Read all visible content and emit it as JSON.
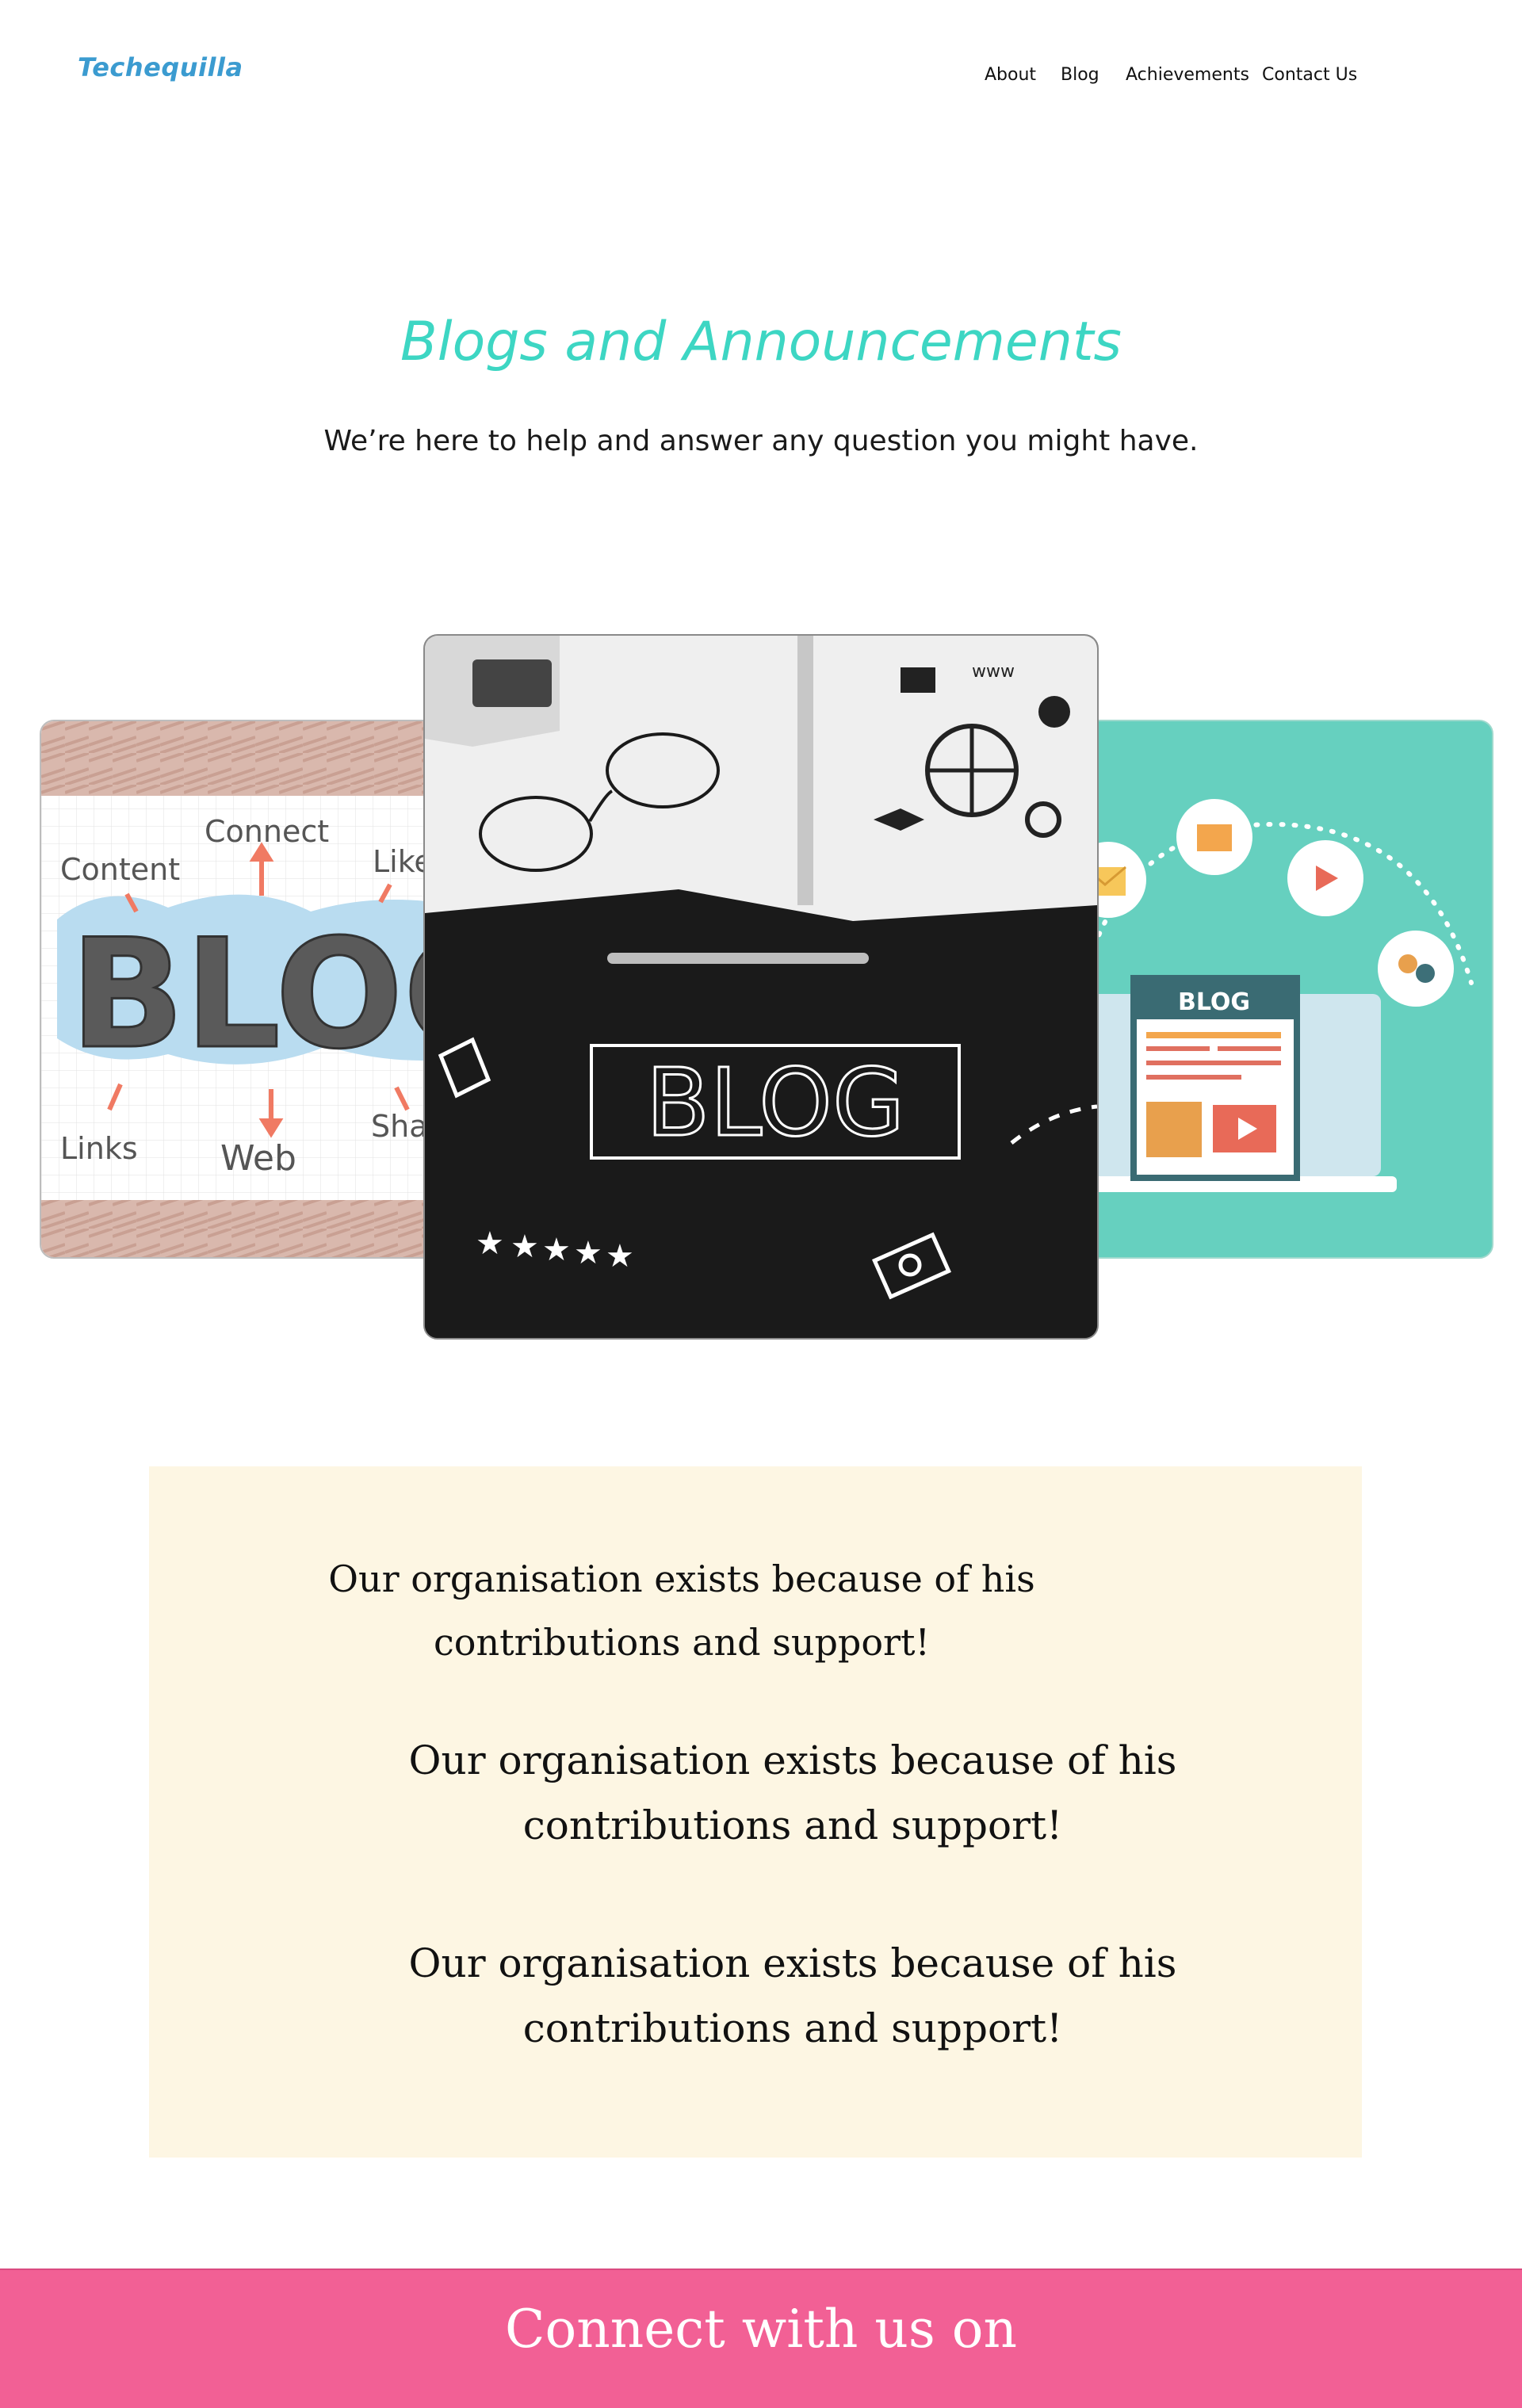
{
  "header": {
    "logo": "Techequilla",
    "nav": [
      "About",
      "Blog",
      "Achievements",
      "Contact Us"
    ]
  },
  "hero": {
    "title": "Blogs and Announcements",
    "subtitle": "We’re here to help and answer any question you might have."
  },
  "gallery": {
    "left_image": {
      "word": "BLOG",
      "tags": [
        "Content",
        "Connect",
        "Like",
        "Links",
        "Web",
        "Sha"
      ]
    },
    "center_image": {
      "word": "BLOG",
      "accent_text": "www"
    },
    "right_image": {
      "word": "BLOG",
      "background": "#66d0bf"
    }
  },
  "support": {
    "lines": [
      "Our organisation exists because of his contributions and support!",
      "Our organisation exists because of his contributions and support!",
      "Our organisation exists because of his contributions and support!"
    ]
  },
  "footer": {
    "text": "Connect with us on"
  },
  "colors": {
    "logo": "#3b9bd0",
    "title_accent": "#3dd6c3",
    "support_bg": "#fdf6e3",
    "footer_bg": "#f26095"
  }
}
